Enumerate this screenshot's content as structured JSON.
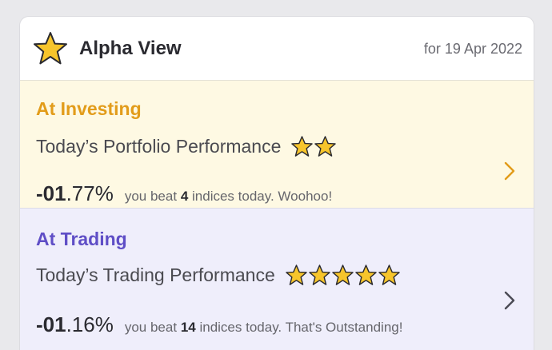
{
  "header": {
    "logo_icon": "star-logo-icon",
    "title": "Alpha View",
    "date": "for 19 Apr 2022"
  },
  "investing": {
    "title": "At Investing",
    "performance_label": "Today’s Portfolio Performance",
    "stars": 2,
    "change_int": "-01",
    "change_dec": ".77%",
    "beat_prefix": "you beat",
    "beat_count": "4",
    "beat_suffix": "indices today. Woohoo!",
    "accent_color": "#e29c1a",
    "background": "#fef9e3"
  },
  "trading": {
    "title": "At Trading",
    "performance_label": "Today’s Trading Performance",
    "stars": 5,
    "change_int": "-01",
    "change_dec": ".16%",
    "beat_prefix": "you beat",
    "beat_count": "14",
    "beat_suffix": "indices today. That's Outstanding!",
    "accent_color": "#5f4ec6",
    "background": "#efeefb"
  },
  "colors": {
    "star_fill": "#f7c52b",
    "star_stroke": "#2a2a30"
  }
}
